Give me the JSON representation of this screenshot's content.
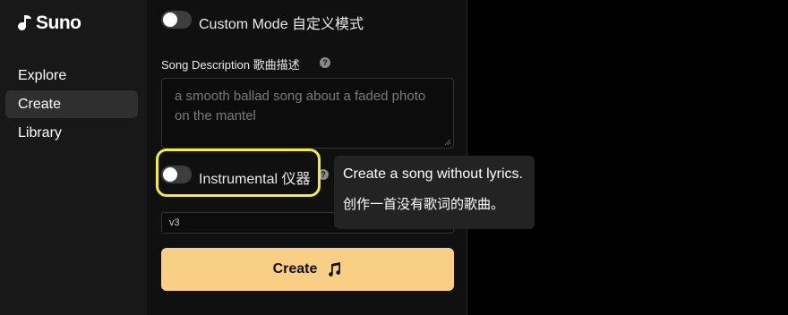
{
  "app": {
    "name": "Suno"
  },
  "sidebar": {
    "items": [
      {
        "label": "Explore",
        "active": false
      },
      {
        "label": "Create",
        "active": true
      },
      {
        "label": "Library",
        "active": false
      }
    ]
  },
  "form": {
    "custom_mode": {
      "label": "Custom Mode 自定义模式",
      "on": false
    },
    "song_description": {
      "label": "Song Description 歌曲描述",
      "placeholder": "a smooth ballad song about a faded photo on the mantel"
    },
    "instrumental": {
      "label": "Instrumental 仪器",
      "on": false
    },
    "version": {
      "value": "v3"
    },
    "create_button": {
      "label": "Create"
    }
  },
  "tooltip": {
    "line1": "Create a song without lyrics.",
    "line2": "创作一首没有歌词的歌曲。"
  },
  "colors": {
    "highlight": "#f4ec3a",
    "create_button": "#f8cf85",
    "sidebar_bg": "#181818",
    "panel_bg": "#101010"
  },
  "icons": {
    "logo": "suno-logo-icon",
    "help": "question-circle-icon",
    "create": "music-note-icon"
  }
}
